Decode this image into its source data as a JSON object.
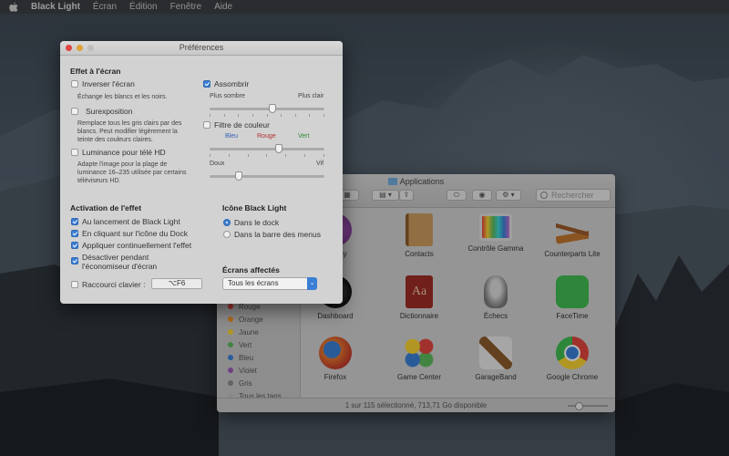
{
  "menubar": {
    "app_name": "Black Light",
    "items": [
      "Écran",
      "Édition",
      "Fenêtre",
      "Aide"
    ]
  },
  "finder": {
    "title": "Applications",
    "search_placeholder": "Rechercher",
    "status": "1 sur 115 sélectionné, 713,71 Go disponible",
    "tags": [
      {
        "label": "Rouge",
        "color": "#e0443e"
      },
      {
        "label": "Orange",
        "color": "#f0932b"
      },
      {
        "label": "Jaune",
        "color": "#f5d033"
      },
      {
        "label": "Vert",
        "color": "#5cb85c"
      },
      {
        "label": "Bleu",
        "color": "#3b7fd5"
      },
      {
        "label": "Violet",
        "color": "#9b59b6"
      },
      {
        "label": "Gris",
        "color": "#8a8a8a"
      },
      {
        "label": "Tous les tags…",
        "color": "#bdbdbd"
      }
    ],
    "apps": [
      {
        "label": "…oquy",
        "icon": "quoqy-icon"
      },
      {
        "label": "Contacts",
        "icon": "contacts-icon"
      },
      {
        "label": "Contrôle Gamma",
        "icon": "gamma-icon"
      },
      {
        "label": "Counterparts Lite",
        "icon": "signpost-icon"
      },
      {
        "label": "Dashboard",
        "icon": "dashboard-icon"
      },
      {
        "label": "Dictionnaire",
        "icon": "dictionary-icon"
      },
      {
        "label": "Échecs",
        "icon": "chess-icon"
      },
      {
        "label": "FaceTime",
        "icon": "facetime-icon"
      },
      {
        "label": "Firefox",
        "icon": "firefox-icon"
      },
      {
        "label": "Game Center",
        "icon": "gamecenter-icon"
      },
      {
        "label": "GarageBand",
        "icon": "guitar-icon"
      },
      {
        "label": "Google Chrome",
        "icon": "chrome-icon"
      }
    ]
  },
  "prefs": {
    "title": "Préférences",
    "screen_effect": {
      "heading": "Effet à l'écran",
      "invert_label": "Inverser l'écran",
      "invert_desc": "Échange les blancs et les noirs.",
      "overexposure_label": "Surexposition",
      "overexposure_desc": [
        "Remplace tous les gris clairs par des",
        "blancs. Peut modifier légèrement la",
        "teinte des couleurs claires."
      ],
      "hd_label": "Luminance pour télé HD",
      "hd_desc": [
        "Adapte l'image pour la plage de",
        "luminance 16–235 utilisée par certains",
        "téléviseurs HD."
      ],
      "darken_label": "Assombrir",
      "darken_left": "Plus sombre",
      "darken_right": "Plus clair",
      "darken_level": 0.55,
      "color_filter_label": "Filtre de couleur",
      "color_blue": "Bleu",
      "color_red": "Rouge",
      "color_green": "Vert",
      "color_level": 0.6,
      "soft_label": "Doux",
      "vivid_label": "Vif",
      "softness_level": 0.25
    },
    "activation": {
      "heading": "Activation de l'effet",
      "launch_label": "Au lancement de Black Light",
      "dock_click_label": "En cliquant sur l'icône du Dock",
      "continuous_label": "Appliquer continuellement l'effet",
      "screensaver_label": [
        "Désactiver pendant",
        "l'économiseur d'écran"
      ],
      "shortcut_label": "Raccourci clavier :",
      "shortcut_value": "⌥F6"
    },
    "icon": {
      "heading": "Icône Black Light",
      "in_dock": "Dans le dock",
      "in_menubar": "Dans la barre des menus"
    },
    "screens": {
      "heading": "Écrans affectés",
      "selected": "Tous les écrans"
    }
  }
}
